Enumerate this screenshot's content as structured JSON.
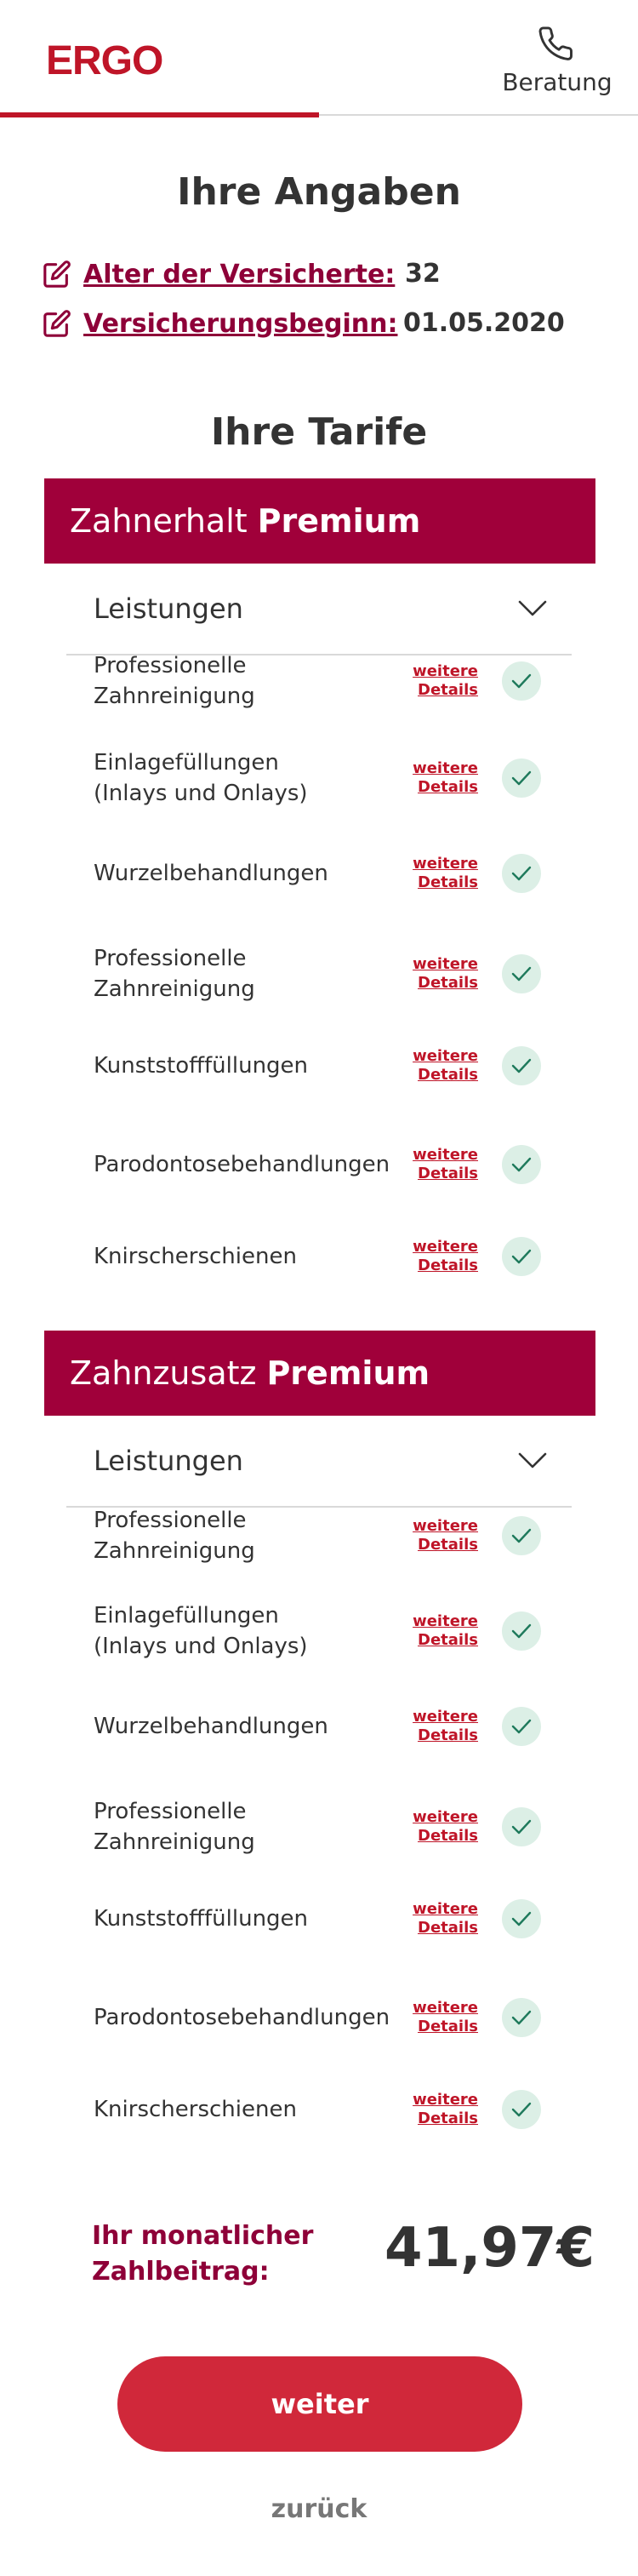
{
  "header": {
    "logo": "ERGO",
    "beratung_label": "Beratung",
    "progress_percent": 50,
    "brand_color": "#bf1528"
  },
  "angaben": {
    "title": "Ihre Angaben",
    "rows": [
      {
        "label": "Alter der Versicherte:",
        "value": "32"
      },
      {
        "label": "Versicherungsbeginn:",
        "value": "01.05.2020"
      }
    ]
  },
  "tarife": {
    "title": "Ihre Tarife",
    "items": [
      {
        "name": "Zahnerhalt",
        "tier": "Premium",
        "leistungen_label": "Leistungen",
        "details_line1": "weitere",
        "details_line2": "Details",
        "benefits": [
          "Professionelle Zahnreinigung",
          "Einlagefüllungen\n(Inlays und Onlays)",
          "Wurzelbehandlungen",
          "Professionelle Zahnreinigung",
          "Kunststofffüllungen",
          "Parodontosebehandlungen",
          "Knirscherschienen"
        ]
      },
      {
        "name": "Zahnzusatz",
        "tier": "Premium",
        "leistungen_label": "Leistungen",
        "details_line1": "weitere",
        "details_line2": "Details",
        "benefits": [
          "Professionelle Zahnreinigung",
          "Einlagefüllungen\n(Inlays und Onlays)",
          "Wurzelbehandlungen",
          "Professionelle Zahnreinigung",
          "Kunststofffüllungen",
          "Parodontosebehandlungen",
          "Knirscherschienen"
        ]
      }
    ]
  },
  "summary": {
    "price_label": "Ihr monatlicher\nZahlbeitrag:",
    "price": "41,97€"
  },
  "actions": {
    "next_label": "weiter",
    "back_label": "zurück"
  }
}
